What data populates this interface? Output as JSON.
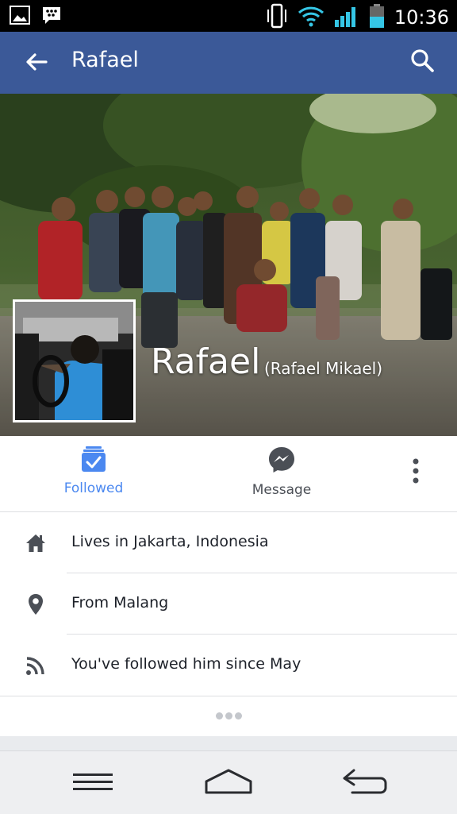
{
  "status_bar": {
    "time": "10:36",
    "icons": [
      "gallery-icon",
      "bbm-icon",
      "vibrate-icon",
      "wifi-icon",
      "signal-icon",
      "battery-icon"
    ]
  },
  "toolbar": {
    "title": "Rafael",
    "back_icon": "back-arrow-icon",
    "search_icon": "search-icon",
    "color": "#3b5998"
  },
  "profile": {
    "name": "Rafael",
    "alternate_name": "(Rafael Mikael)"
  },
  "actions": {
    "followed": {
      "label": "Followed",
      "icon": "followed-icon",
      "color": "#4b88f0"
    },
    "message": {
      "label": "Message",
      "icon": "messenger-icon"
    },
    "more": {
      "icon": "more-vertical-icon"
    }
  },
  "info": [
    {
      "icon": "home-icon",
      "text": "Lives in Jakarta, Indonesia"
    },
    {
      "icon": "location-pin-icon",
      "text": "From Malang"
    },
    {
      "icon": "rss-icon",
      "text": "You've followed him since May"
    }
  ],
  "nav_bar": [
    "menu-icon",
    "home-nav-icon",
    "back-nav-icon"
  ]
}
